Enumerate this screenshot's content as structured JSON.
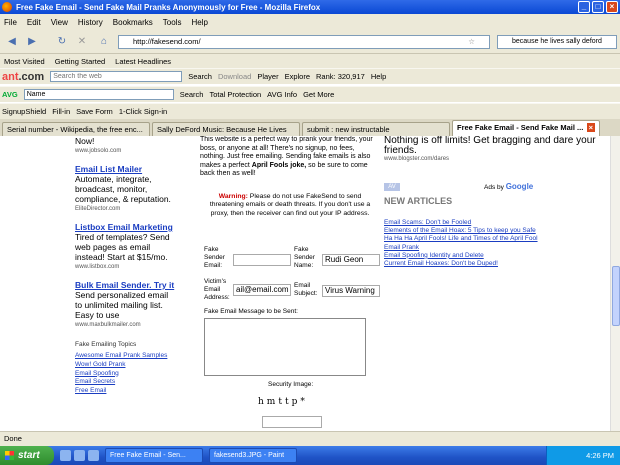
{
  "window": {
    "title": "Free Fake Email - Send Fake Mail Pranks Anonymously for Free - Mozilla Firefox"
  },
  "menu": [
    "File",
    "Edit",
    "View",
    "History",
    "Bookmarks",
    "Tools",
    "Help"
  ],
  "nav": {
    "url": "http://fakesend.com/",
    "search_value": "because he lives sally deford"
  },
  "bookmarks": [
    "Most Visited",
    "Getting Started",
    "Latest Headlines"
  ],
  "ant_toolbar": {
    "search_placeholder": "Search the web",
    "search": "Search",
    "download": "Download",
    "player": "Player",
    "explore": "Explore",
    "rank": "Rank: 320,917",
    "help": "Help"
  },
  "avg_toolbar": {
    "name_value": "Name",
    "search": "Search",
    "total_protection": "Total Protection",
    "avg_info": "AVG Info",
    "get_more": "Get More"
  },
  "extra_toolbar": [
    "SignupShield",
    "Fill-in",
    "Save Form",
    "1-Click Sign-in"
  ],
  "tabs": [
    "Serial number - Wikipedia, the free enc...",
    "Sally DeFord Music: Because He Lives",
    "submit : new instructable",
    "Free Fake Email - Send Fake Mail ..."
  ],
  "left": {
    "top_text": "Now!",
    "top_url": "www.jobsolo.com",
    "ads": [
      {
        "title": "Email List Mailer",
        "body": "Automate, integrate, broadcast, monitor, compliance, & reputation.",
        "url": "EliteDirector.com"
      },
      {
        "title": "Listbox Email Marketing",
        "body": "Tired of templates? Send web pages as email instead! Start at $15/mo.",
        "url": "www.listbox.com"
      },
      {
        "title": "Bulk Email Sender. Try it",
        "body": "Send personalized email to unlimited mailing list. Easy to use",
        "url": "www.maxbulkmailer.com"
      }
    ],
    "topics_title": "Fake Emailing Topics",
    "topics": [
      "Awesome Email Prank Samples",
      "Wow! Gold Prank",
      "Email Spoofing",
      "Email Secrets",
      "Free Email"
    ]
  },
  "middle": {
    "intro": "This website is a perfect way to prank your friends, your boss, or anyone at all! There's no signup, no fees, nothing. Just free emailing. Sending fake emails is also makes a perfect",
    "intro_bold": "April Fools joke,",
    "intro_tail": "so be sure to come back then as well!",
    "warning_label": "Warning:",
    "warning_text": "Please do not use FakeSend to send threatening emails or death threats. If you don't use a proxy, then the receiver can find out your IP address.",
    "sender_email_label": "Fake Sender Email:",
    "sender_email_value": "",
    "sender_name_label": "Fake Sender Name:",
    "sender_name_value": "Rudi Geon",
    "victim_label": "Victim's Email Address:",
    "victim_value": "ail@email.com",
    "subject_label": "Email Subject:",
    "subject_value": "Virus Warning",
    "message_label": "Fake Email Message to be Sent:",
    "security_label": "Security Image:",
    "captcha": "hmttp*"
  },
  "right": {
    "top_title": "Nothing is off limits! Get bragging and dare your friends.",
    "top_url": "www.blogster.com/dares",
    "ads_by": "Ads by",
    "google": "Google",
    "av": "AV",
    "new_articles": "NEW ARTICLES",
    "articles": [
      "Email Scams: Don't be Fooled",
      "Elements of the Email Hoax: 5 Tips to keep you Safe",
      "Ha Ha Ha April Fools! Life and Times of the April Fool",
      "Email Prank",
      "Email Spoofing Identity and Delete",
      "Current Email Hoaxes: Don't be Duped!"
    ]
  },
  "status": "Done",
  "taskbar": {
    "start": "start",
    "tasks": [
      "Free Fake Email - Sen...",
      "fakesend3.JPG - Paint"
    ],
    "time": "4:26 PM"
  }
}
